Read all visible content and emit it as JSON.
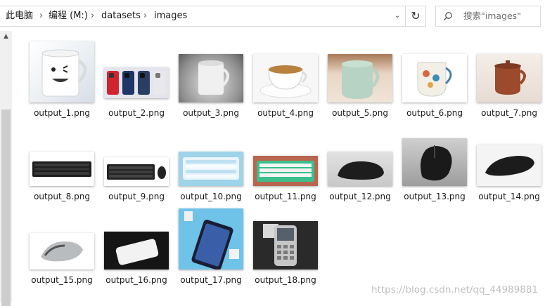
{
  "breadcrumb": {
    "items": [
      "此电脑",
      "编程 (M:)",
      "datasets",
      "images"
    ],
    "separator": "›"
  },
  "icons": {
    "dropdown": "chevron-down-icon",
    "refresh": "refresh-icon",
    "search": "magnifier-icon"
  },
  "search": {
    "placeholder": "搜索\"images\""
  },
  "files": [
    {
      "name": "output_1.png",
      "thumb": "white mug with smiley face"
    },
    {
      "name": "output_2.png",
      "thumb": "three smartphones red blue white"
    },
    {
      "name": "output_3.png",
      "thumb": "white mug grey background"
    },
    {
      "name": "output_4.png",
      "thumb": "white coffee cup with saucer"
    },
    {
      "name": "output_5.png",
      "thumb": "pale green ceramic mug"
    },
    {
      "name": "output_6.png",
      "thumb": "floral patterned cup"
    },
    {
      "name": "output_7.png",
      "thumb": "brown clay mug with lid"
    },
    {
      "name": "output_8.png",
      "thumb": "black mechanical keyboard"
    },
    {
      "name": "output_9.png",
      "thumb": "black keyboard"
    },
    {
      "name": "output_10.png",
      "thumb": "light blue keyboard"
    },
    {
      "name": "output_11.png",
      "thumb": "white green keyboard"
    },
    {
      "name": "output_12.png",
      "thumb": "black mouse"
    },
    {
      "name": "output_13.png",
      "thumb": "black gaming mouse"
    },
    {
      "name": "output_14.png",
      "thumb": "black arc mouse"
    },
    {
      "name": "output_15.png",
      "thumb": "silver arc mouse"
    },
    {
      "name": "output_16.png",
      "thumb": "white phone on black"
    },
    {
      "name": "output_17.png",
      "thumb": "phone on blue background"
    },
    {
      "name": "output_18.png",
      "thumb": "silver feature phone"
    }
  ],
  "watermark": "https://blog.csdn.net/qq_44989881",
  "colors": {
    "border": "#d9d9d9",
    "scroll_track": "#f0f0f0",
    "scroll_thumb": "#cdcdcd"
  }
}
